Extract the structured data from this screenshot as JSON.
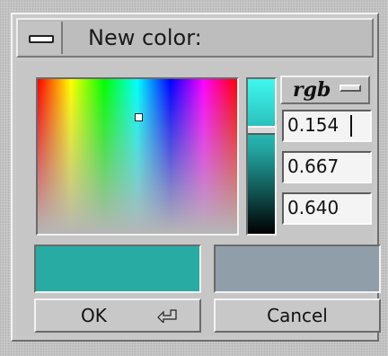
{
  "dialog": {
    "title": "New color:",
    "mode_label": "rgb",
    "fields": [
      "0.154",
      "0.667",
      "0.640"
    ],
    "ok_label": "OK",
    "cancel_label": "Cancel"
  },
  "colors": {
    "new_color": "#27ABA3",
    "old_color": "#8F9EA8",
    "value_strip_top": "#3EF8F0"
  },
  "icons": {
    "window_menu": "window-menu-icon",
    "mode_dropdown": "option-menu-icon",
    "ok_enter": "enter-key-icon"
  }
}
